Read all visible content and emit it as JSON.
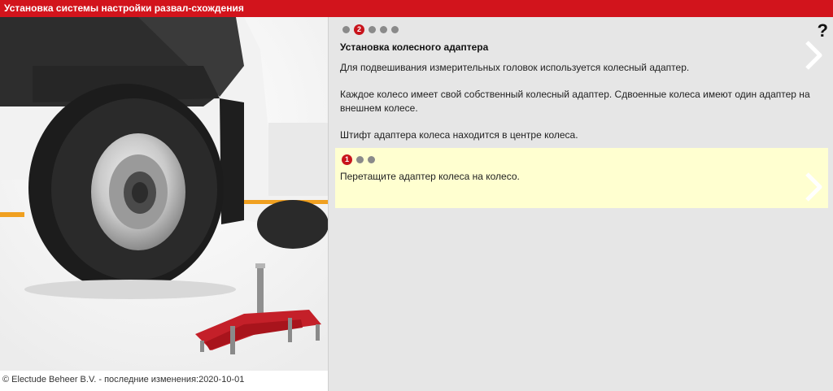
{
  "window": {
    "title": "Установка системы настройки развал-схождения"
  },
  "footer": {
    "copyright": "© Electude Beheer B.V. - последние изменения:2020-10-01"
  },
  "help": {
    "label": "?"
  },
  "steps": {
    "current_label": "2",
    "count": 5,
    "current_index": 2
  },
  "content": {
    "title": "Установка колесного адаптера",
    "paragraph1": "Для подвешивания измерительных головок используется колесный адаптер.",
    "paragraph2": "Каждое колесо имеет свой собственный колесный адаптер. Сдвоенные колеса имеют один адаптер на внешнем колесе.",
    "paragraph3": "Штифт адаптера колеса находится в центре колеса."
  },
  "task": {
    "current_label": "1",
    "count": 3,
    "current_index": 1,
    "instruction": "Перетащите адаптер колеса на колесо."
  },
  "colors": {
    "accent": "#d2141c",
    "task_background": "#ffffd0"
  },
  "icons": {
    "help": "question-mark-icon",
    "next": "chevron-right-icon"
  }
}
